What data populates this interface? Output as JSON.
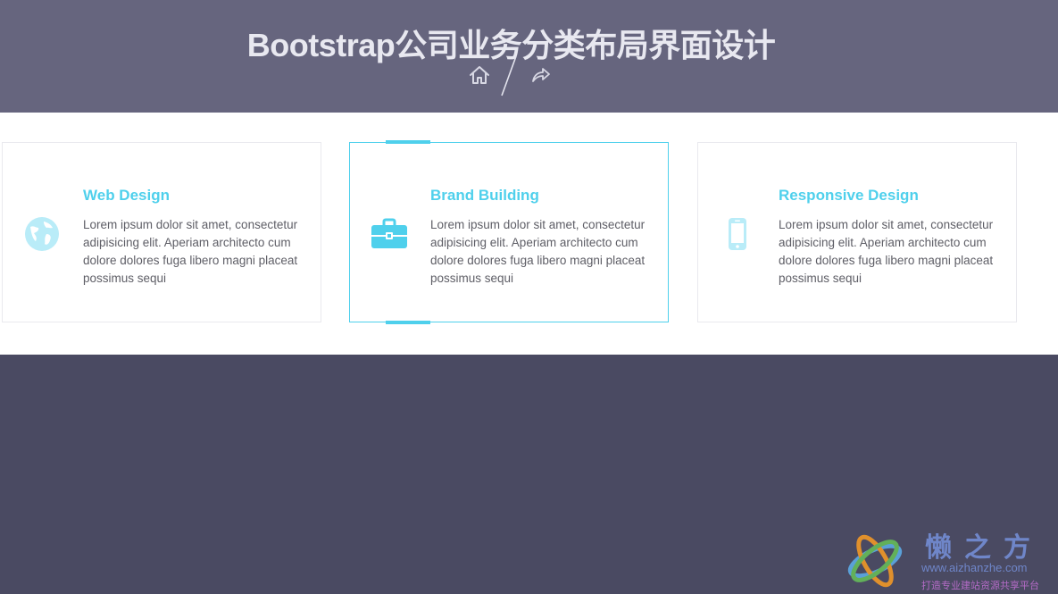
{
  "header": {
    "title": "Bootstrap公司业务分类布局界面设计",
    "breadcrumb": {
      "home_icon": "home-icon",
      "separator": "/",
      "share_icon": "share-icon"
    }
  },
  "services": [
    {
      "title": "Web Design",
      "text": "Lorem ipsum dolor sit amet, consectetur adipisicing elit. Aperiam architecto cum dolore dolores fuga libero magni placeat possimus sequi",
      "icon": "globe-icon",
      "active": false
    },
    {
      "title": "Brand Building",
      "text": "Lorem ipsum dolor sit amet, consectetur adipisicing elit. Aperiam architecto cum dolore dolores fuga libero magni placeat possimus sequi",
      "icon": "briefcase-icon",
      "active": true
    },
    {
      "title": "Responsive Design",
      "text": "Lorem ipsum dolor sit amet, consectetur adipisicing elit. Aperiam architecto cum dolore dolores fuga libero magni placeat possimus sequi",
      "icon": "mobile-phone-icon",
      "active": false
    }
  ],
  "watermark": {
    "title": "懒之方",
    "url": "www.aizhanzhe.com",
    "slogan": "打造专业建站资源共享平台"
  },
  "colors": {
    "header_bg": "#66657e",
    "page_bg": "#4a4a62",
    "accent": "#4fd0ec",
    "light_accent": "#b9ecf8",
    "text": "#5e5e66"
  }
}
